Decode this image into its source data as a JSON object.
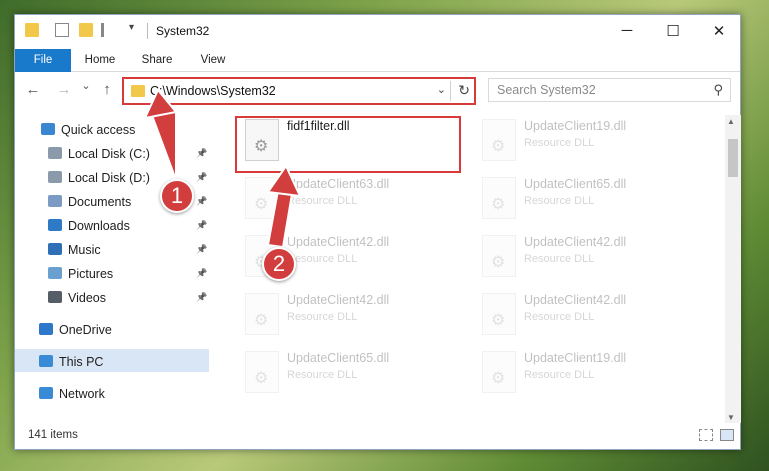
{
  "window": {
    "title": "System32"
  },
  "controls": {
    "minimize": "─",
    "maximize": "☐",
    "close": "✕"
  },
  "ribbon": {
    "tabs": [
      "File",
      "Home",
      "Share",
      "View"
    ]
  },
  "address": {
    "path": "C:\\Windows\\System32",
    "dropdown_glyph": "⌄",
    "refresh_glyph": "↻"
  },
  "search": {
    "placeholder": "Search System32",
    "icon": "⚲"
  },
  "nav_buttons": {
    "back": "←",
    "forward": "→",
    "recent": "⌄",
    "up": "↑"
  },
  "nav": {
    "items": [
      {
        "label": "Quick access",
        "icon": "star-icon",
        "color": "#3a86d0",
        "pinned": false
      },
      {
        "label": "Local Disk (C:)",
        "icon": "drive-icon",
        "color": "#8a9aab",
        "pinned": true
      },
      {
        "label": "Local Disk (D:)",
        "icon": "drive-icon",
        "color": "#8a9aab",
        "pinned": true
      },
      {
        "label": "Documents",
        "icon": "documents-icon",
        "color": "#7c9bc4",
        "pinned": true
      },
      {
        "label": "Downloads",
        "icon": "downloads-icon",
        "color": "#2f7ac7",
        "pinned": true
      },
      {
        "label": "Music",
        "icon": "music-icon",
        "color": "#2f6fb8",
        "pinned": true
      },
      {
        "label": "Pictures",
        "icon": "pictures-icon",
        "color": "#6aa0d0",
        "pinned": true
      },
      {
        "label": "Videos",
        "icon": "videos-icon",
        "color": "#555d66",
        "pinned": true
      },
      {
        "label": "OneDrive",
        "icon": "onedrive-icon",
        "color": "#2d78c9",
        "pinned": false
      },
      {
        "label": "This PC",
        "icon": "computer-icon",
        "color": "#3a8bd6",
        "pinned": false,
        "selected": true
      },
      {
        "label": "Network",
        "icon": "network-icon",
        "color": "#3a8bd6",
        "pinned": false
      }
    ],
    "pin_glyph": "📌"
  },
  "files": [
    {
      "name": "fidf1filter.dll",
      "type": "",
      "highlighted": true
    },
    {
      "name": "UpdateClient19.dll",
      "type": "Resource DLL"
    },
    {
      "name": "UpdateClient63.dll",
      "type": "Resource DLL"
    },
    {
      "name": "UpdateClient65.dll",
      "type": "Resource DLL"
    },
    {
      "name": "UpdateClient42.dll",
      "type": "Resource DLL"
    },
    {
      "name": "UpdateClient42.dll",
      "type": "Resource DLL"
    },
    {
      "name": "UpdateClient42.dll",
      "type": "Resource DLL"
    },
    {
      "name": "UpdateClient42.dll",
      "type": "Resource DLL"
    },
    {
      "name": "UpdateClient65.dll",
      "type": "Resource DLL"
    },
    {
      "name": "UpdateClient19.dll",
      "type": "Resource DLL"
    }
  ],
  "status": {
    "item_count": "141 items"
  },
  "annotations": {
    "step1": "1",
    "step2": "2",
    "accent": "#d23d3d"
  }
}
